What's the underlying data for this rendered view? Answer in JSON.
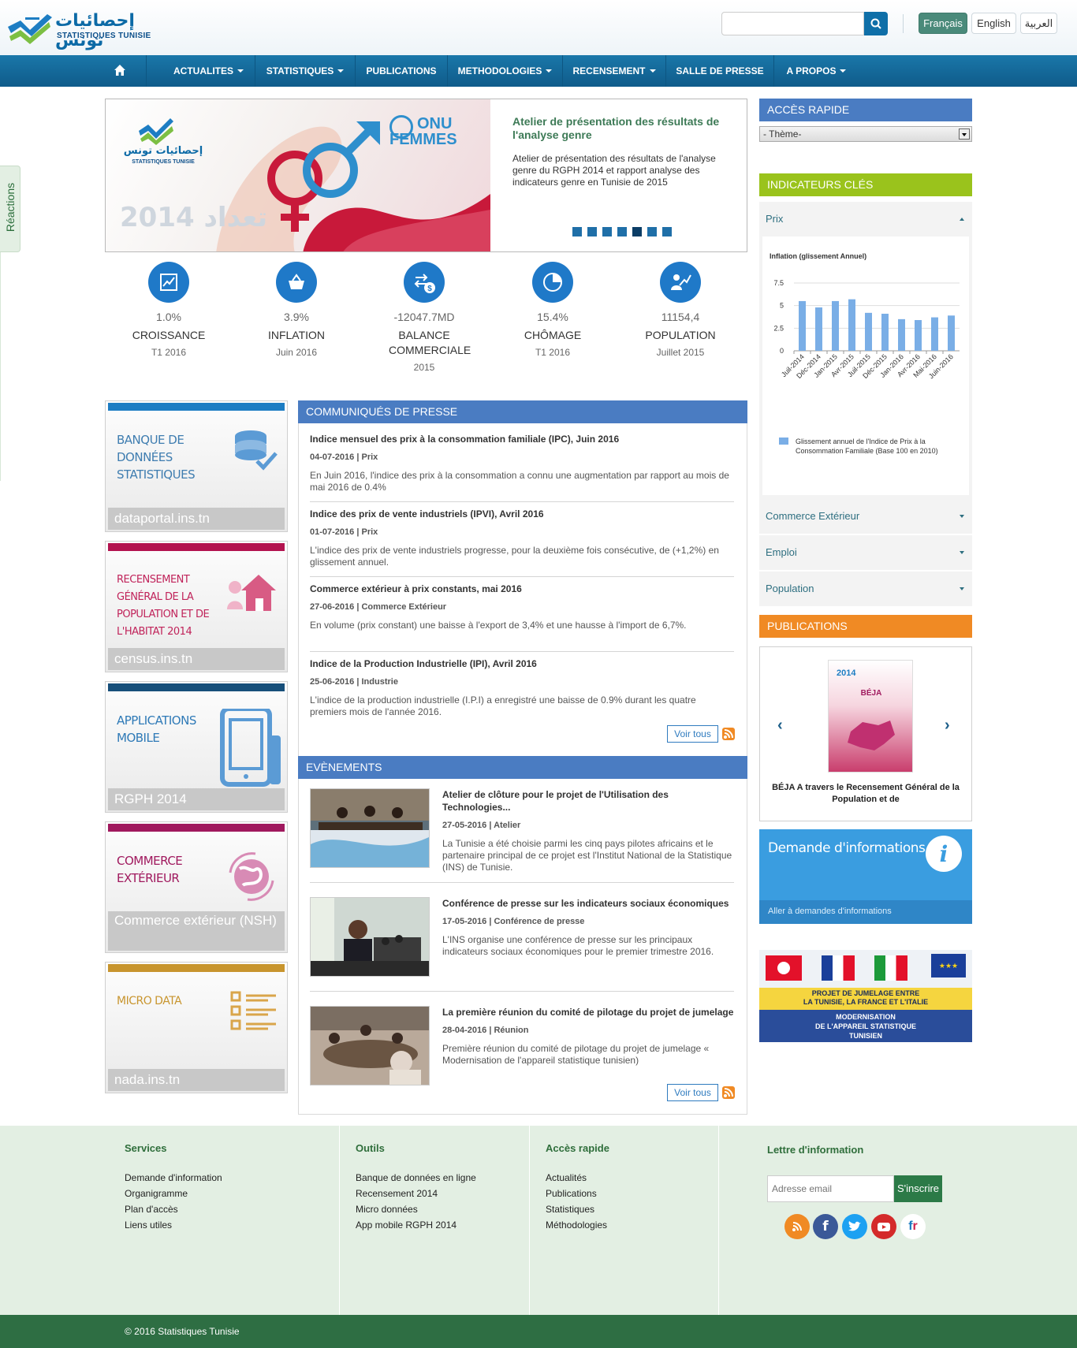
{
  "header": {
    "logo_ar": "إحصائيات تونس",
    "logo_fr": "STATISTIQUES TUNISIE",
    "search_placeholder": "",
    "languages": [
      "Français",
      "English",
      "العربية"
    ]
  },
  "nav": {
    "items": [
      {
        "label": "ACTUALITES",
        "dropdown": true
      },
      {
        "label": "STATISTIQUES",
        "dropdown": true
      },
      {
        "label": "PUBLICATIONS",
        "dropdown": false
      },
      {
        "label": "METHODOLOGIES",
        "dropdown": true
      },
      {
        "label": "RECENSEMENT",
        "dropdown": true
      },
      {
        "label": "SALLE DE PRESSE",
        "dropdown": false
      },
      {
        "label": "A PROPOS",
        "dropdown": true
      }
    ]
  },
  "reactions_label": "Réactions",
  "slider": {
    "title": "Atelier de présentation des résultats de l'analyse genre",
    "text": "Atelier de présentation des résultats de l'analyse genre du RGPH 2014 et rapport analyse des indicateurs genre en Tunisie de 2015",
    "logo_ar": "إحصائيات تونس",
    "logo_fr": "STATISTIQUES TUNISIE",
    "onu_line1": "ONU",
    "onu_line2": "FEMMES",
    "census_text": "تعداد 2014",
    "dot_count": 7,
    "active_dot": 5
  },
  "kpis": [
    {
      "icon": "growth-chart-icon",
      "value": "1.0%",
      "name": "CROISSANCE",
      "date": "T1 2016"
    },
    {
      "icon": "shopping-basket-icon",
      "value": "3.9%",
      "name": "INFLATION",
      "date": "Juin 2016"
    },
    {
      "icon": "exchange-dollar-icon",
      "value": "-12047.7MD",
      "name": "BALANCE COMMERCIALE",
      "date": "2015"
    },
    {
      "icon": "pie-chart-icon",
      "value": "15.4%",
      "name": "CHÔMAGE",
      "date": "T1 2016"
    },
    {
      "icon": "population-icon",
      "value": "11154,4",
      "name": "POPULATION",
      "date": "Juillet 2015"
    }
  ],
  "left_banners": [
    {
      "title": "BANQUE DE DONNÉES STATISTIQUES",
      "footer": "dataportal.ins.tn",
      "color": "#1d7dc3",
      "text_color": "#3f7db0",
      "icon": "database-icon"
    },
    {
      "title": "RECENSEMENT GÉNÉRAL DE LA POPULATION ET DE L'HABITAT 2014",
      "footer": "census.ins.tn",
      "color": "#b3134f",
      "text_color": "#c0235a",
      "icon": "house-icon"
    },
    {
      "title": "APPLICATIONS MOBILE",
      "footer": "RGPH 2014",
      "color": "#174f7a",
      "text_color": "#2f7ab7",
      "icon": "mobile-phone-icon"
    },
    {
      "title": "COMMERCE EXTÉRIEUR",
      "footer": "Commerce extérieur (NSH)",
      "color": "#a0195e",
      "text_color": "#a0195e",
      "icon": "globe-icon"
    },
    {
      "title": "MICRO DATA",
      "footer": "nada.ins.tn",
      "color": "#c8952e",
      "text_color": "#c8952e",
      "icon": "list-icon"
    }
  ],
  "press": {
    "heading": "COMMUNIQUÉS DE PRESSE",
    "items": [
      {
        "title": "Indice mensuel des prix à la consommation familiale (IPC), Juin 2016",
        "date": "04-07-2016",
        "category": "Prix",
        "text": "En Juin 2016, l'indice des prix à la consommation a connu une augmentation par rapport au mois de mai 2016 de 0.4%"
      },
      {
        "title": "Indice des prix de vente industriels (IPVI), Avril 2016",
        "date": "01-07-2016",
        "category": "Prix",
        "text": "L'indice des prix de vente industriels progresse, pour la deuxième fois consécutive, de (+1,2%) en glissement annuel."
      },
      {
        "title": "Commerce extérieur à prix constants, mai 2016",
        "date": "27-06-2016",
        "category": "Commerce Extérieur",
        "text": "En volume (prix constant) une baisse à l'export de 3,4% et une hausse à l'import de 6,7%."
      },
      {
        "title": "Indice de la Production Industrielle (IPI), Avril 2016",
        "date": "25-06-2016",
        "category": "Industrie",
        "text": "L'indice de la production industrielle (I.P.I) a enregistré une baisse de 0.9% durant les quatre premiers mois de l'année 2016."
      }
    ],
    "more": "Voir tous"
  },
  "events": {
    "heading": "EVÈNEMENTS",
    "items": [
      {
        "title": "Atelier de clôture pour le projet de l'Utilisation des Technologies...",
        "date": "27-05-2016",
        "category": "Atelier",
        "text": "La Tunisie a été choisie parmi les cinq pays pilotes africains et le partenaire principal de ce projet est l'Institut National de la Statistique (INS) de Tunisie."
      },
      {
        "title": "Conférence de presse sur les indicateurs sociaux économiques",
        "date": "17-05-2016",
        "category": "Conférence de presse",
        "text": "L'INS organise une conférence de presse sur les principaux indicateurs sociaux économiques pour le premier trimestre 2016."
      },
      {
        "title": "La première réunion du comité de pilotage du projet de jumelage",
        "date": "28-04-2016",
        "category": "Réunion",
        "text": "Première réunion du comité de pilotage du projet de jumelage « Modernisation de l'appareil statistique tunisien)"
      }
    ],
    "more": "Voir tous"
  },
  "acces_rapide": {
    "heading": "ACCÈS RAPIDE",
    "select_value": "- Thème-"
  },
  "indicateurs": {
    "heading": "INDICATEURS CLÉS",
    "open_item": "Prix",
    "closed_items": [
      "Commerce Extérieur",
      "Emploi",
      "Population"
    ]
  },
  "chart_data": {
    "type": "bar",
    "title": "Inflation (glissement Annuel)",
    "categories": [
      "Juil-2014",
      "Déc-2014",
      "Jan-2015",
      "Avr-2015",
      "Juil-2015",
      "Déc-2015",
      "Jan-2016",
      "Avr-2016",
      "Mai-2016",
      "Juin-2016"
    ],
    "series": [
      {
        "name": "Glissement annuel de l'Indice de Prix à la Consommation Familiale (Base 100 en 2010)",
        "values": [
          5.5,
          4.8,
          5.5,
          5.7,
          4.2,
          4.1,
          3.5,
          3.4,
          3.7,
          3.9
        ]
      }
    ],
    "yticks": [
      "0",
      "2.5",
      "5",
      "7.5"
    ],
    "ylim": [
      0,
      7.5
    ],
    "grid": true,
    "legend_position": "bottom",
    "color": "#7aaee6"
  },
  "publications": {
    "heading": "PUBLICATIONS",
    "caption": "BÉJA A travers le Recensement Général de la Population et de",
    "cover_title": "BÉJA",
    "cover_year": "2014"
  },
  "demande": {
    "title": "Demande d'informations",
    "link": "Aller à demandes d'informations"
  },
  "jumelage": {
    "line1": "PROJET DE JUMELAGE ENTRE",
    "line2": "LA TUNISIE, LA FRANCE ET L'ITALIE",
    "line3": "MODERNISATION",
    "line4": "DE L'APPAREIL STATISTIQUE",
    "line5": "TUNISIEN"
  },
  "footer": {
    "services": {
      "title": "Services",
      "links": [
        "Demande d'information",
        "Organigramme",
        "Plan d'accès",
        "Liens utiles"
      ]
    },
    "outils": {
      "title": "Outils",
      "links": [
        "Banque de données en ligne",
        "Recensement 2014",
        "Micro données",
        "App mobile RGPH 2014"
      ]
    },
    "acces": {
      "title": "Accès rapide",
      "links": [
        "Actualités",
        "Publications",
        "Statistiques",
        "Méthodologies"
      ]
    },
    "newsletter": {
      "title": "Lettre d'information",
      "placeholder": "Adresse email",
      "button": "S'inscrire"
    },
    "social": [
      "rss-icon",
      "facebook-icon",
      "twitter-icon",
      "youtube-icon",
      "fr-icon"
    ],
    "copyright": "© 2016 Statistiques Tunisie"
  }
}
